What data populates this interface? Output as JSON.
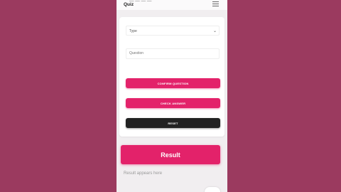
{
  "header": {
    "subtitle": "— — — —",
    "title": "Quiz"
  },
  "form": {
    "type_select_value": "Type",
    "question_placeholder": "Question"
  },
  "buttons": {
    "confirm": "CONFIRM QUESTION",
    "check": "CHECK ANSWER",
    "reset": "RESET",
    "result": "Result"
  },
  "result": {
    "placeholder": "Result appears here"
  },
  "colors": {
    "background": "#9b3a5f",
    "accent": "#e3226a",
    "dark": "#222222"
  },
  "icons": {
    "menu": "hamburger-menu-icon",
    "select_chevron": "chevron-down-icon"
  }
}
